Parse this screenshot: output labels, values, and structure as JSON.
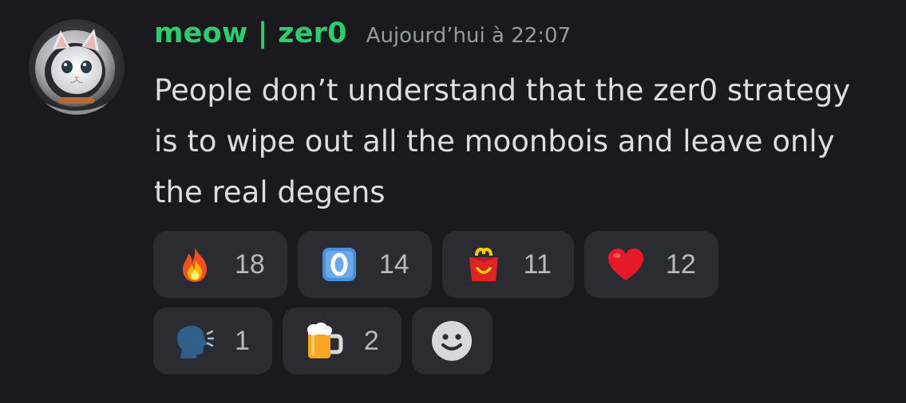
{
  "message": {
    "author": "meow | zer0",
    "author_color": "#2ecc71",
    "timestamp": "Aujourd’hui à 22:07",
    "text": "People don’t understand that the zer0 strategy is to wipe out all the moonbois and leave only the real degens"
  },
  "reactions": [
    {
      "emoji": "fire-icon",
      "count": "18"
    },
    {
      "emoji": "keycap-zero-icon",
      "count": "14"
    },
    {
      "emoji": "happy-meal-icon",
      "count": "11"
    },
    {
      "emoji": "red-heart-icon",
      "count": "12"
    },
    {
      "emoji": "speaking-head-icon",
      "count": "1"
    },
    {
      "emoji": "beer-mug-icon",
      "count": "2"
    }
  ],
  "add_reaction": {
    "icon": "add-reaction-smiley-icon"
  },
  "colors": {
    "background": "#1a1a1e",
    "reaction_bg": "#2b2c31",
    "text": "#dbdee1",
    "muted": "#949ba4"
  }
}
